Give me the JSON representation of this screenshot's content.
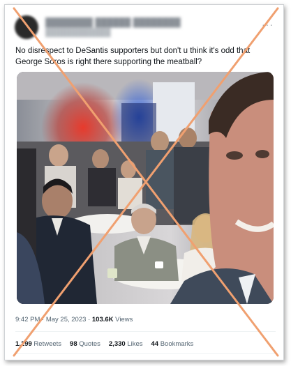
{
  "tweet": {
    "text": "No disrespect to DeSantis supporters but don't u think it's odd that George Soros is right there supporting the meatball?",
    "time": "9:42 PM",
    "date": "May 25, 2023",
    "views_count": "103.6K",
    "views_label": "Views",
    "separator": "·"
  },
  "stats": {
    "retweets_count": "1,199",
    "retweets_label": "Retweets",
    "quotes_count": "98",
    "quotes_label": "Quotes",
    "likes_count": "2,330",
    "likes_label": "Likes",
    "bookmarks_count": "44",
    "bookmarks_label": "Bookmarks"
  },
  "colors": {
    "cross_out": "#f0a070",
    "text": "#0f1419",
    "muted": "#536471"
  },
  "icons": {
    "more": "more-dots-icon"
  }
}
